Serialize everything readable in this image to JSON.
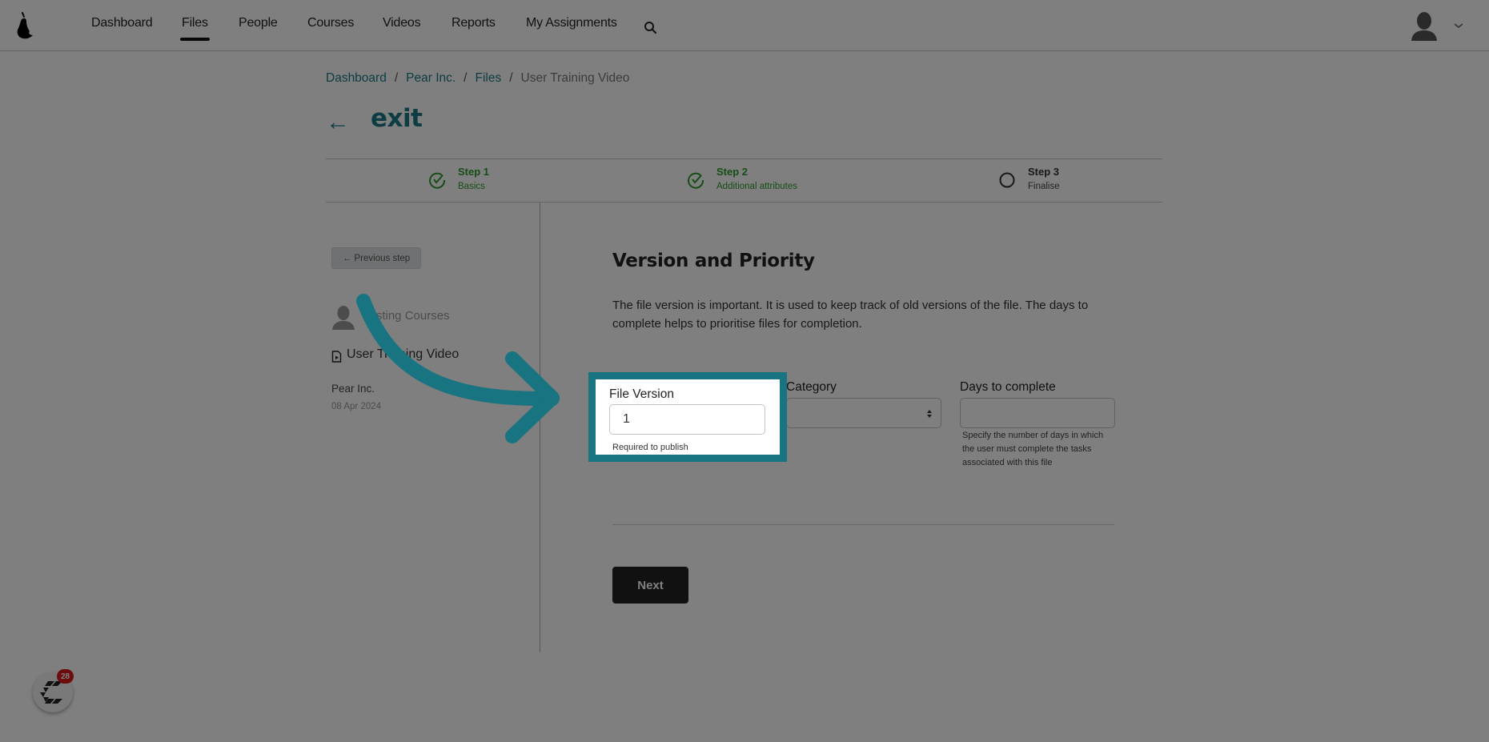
{
  "nav": {
    "items": [
      {
        "label": "Dashboard",
        "active": false
      },
      {
        "label": "Files",
        "active": true
      },
      {
        "label": "People",
        "active": false
      },
      {
        "label": "Courses",
        "active": false
      },
      {
        "label": "Videos",
        "active": false
      },
      {
        "label": "Reports",
        "active": false
      },
      {
        "label": "My Assignments",
        "active": false
      }
    ],
    "logo_icon": "pear-logo-icon",
    "search_icon": "search-icon",
    "user_menu_icon": "user-avatar-icon"
  },
  "breadcrumb": {
    "items": [
      "Dashboard",
      "Pear Inc.",
      "Files"
    ],
    "separator": "/",
    "current": "User Training Video"
  },
  "exit": {
    "arrow": "←",
    "label": "exit"
  },
  "steps": [
    {
      "title": "Step 1",
      "subtitle": "Basics",
      "status": "complete"
    },
    {
      "title": "Step 2",
      "subtitle": "Additional attributes",
      "status": "complete"
    },
    {
      "title": "Step 3",
      "subtitle": "Finalise",
      "status": "pending"
    }
  ],
  "sidebar": {
    "previous_step_label": "← Previous step",
    "course_label": "Testing Courses",
    "file_label": "User Training Video",
    "organization": "Pear Inc.",
    "date": "08 Apr 2024"
  },
  "main": {
    "title": "Version and Priority",
    "description": "The file version is important. It is used to keep track of old versions of the file. The days to complete helps to prioritise files for completion.",
    "fields": {
      "file_version": {
        "label": "File Version",
        "value": "1",
        "help": "Required to publish"
      },
      "category": {
        "label": "Category",
        "value": ""
      },
      "days_to_complete": {
        "label": "Days to complete",
        "value": "",
        "help": "Specify the number of days in which the user must complete the tasks associated with this file"
      }
    },
    "next_label": "Next"
  },
  "chat_widget": {
    "badge_count": "28"
  },
  "colors": {
    "accent": "#1a7a86",
    "highlight": "#177480",
    "step_complete": "#2f9a2f",
    "badge": "#d81818"
  }
}
